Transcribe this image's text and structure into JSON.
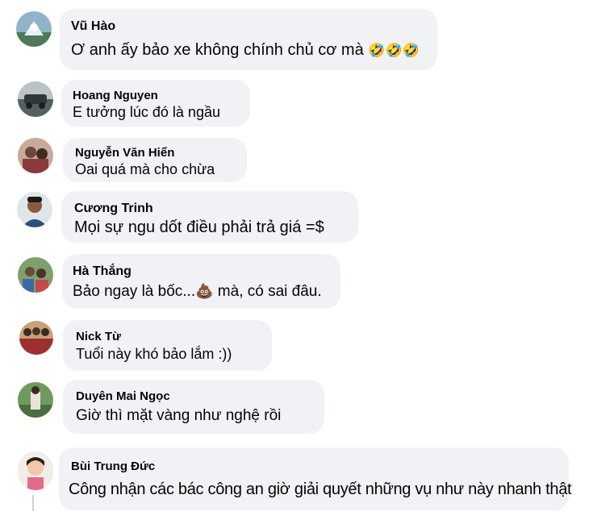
{
  "comments": [
    {
      "author": "Vũ Hào",
      "text": "Ơ anh ấy bảo xe không chính chủ cơ mà",
      "reactions": "🤣🤣🤣"
    },
    {
      "author": "Hoang Nguyen",
      "text": "E tưởng lúc đó là ngầu"
    },
    {
      "author": "Nguyễn Văn Hiển",
      "text": "Oai quá mà cho chừa"
    },
    {
      "author": "Cương Trinh",
      "text": "Mọi sự ngu dốt điều phải trả giá =$"
    },
    {
      "author": "Hà Thắng",
      "text_before": "Bảo ngay là bốc...",
      "emoji": "💩",
      "text_after": " mà, có sai đâu."
    },
    {
      "author": "Nick Từ",
      "text": "Tuổi này khó bảo lắm :))"
    },
    {
      "author": "Duyên Mai Ngọc",
      "text": "Giờ thì mặt vàng như nghệ rồi"
    },
    {
      "author": "Bùi Trung Đức",
      "text": "Công nhận các bác công an giờ giải quyết những vụ như này nhanh thật"
    }
  ],
  "colors": {
    "bubble": "#f0f2f5",
    "text": "#050505",
    "thread_line": "#ccd0d5"
  }
}
